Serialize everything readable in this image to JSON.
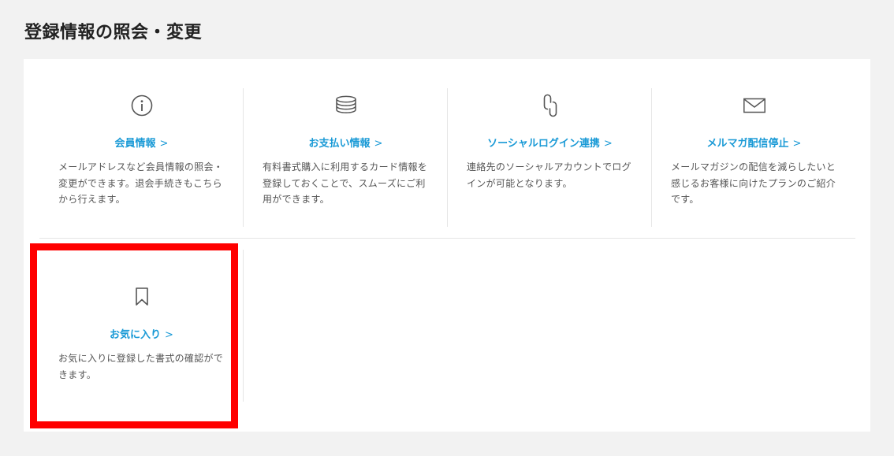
{
  "page": {
    "title": "登録情報の照会・変更"
  },
  "cards": [
    {
      "icon": "info-icon",
      "title": "会員情報",
      "chevron": ">",
      "description": "メールアドレスなど会員情報の照会・変更ができます。退会手続きもこちらから行えます。"
    },
    {
      "icon": "coins-icon",
      "title": "お支払い情報",
      "chevron": ">",
      "description": "有料書式購入に利用するカード情報を登録しておくことで、スムーズにご利用ができます。"
    },
    {
      "icon": "link-icon",
      "title": "ソーシャルログイン連携",
      "chevron": ">",
      "description": "連絡先のソーシャルアカウントでログインが可能となります。"
    },
    {
      "icon": "mail-icon",
      "title": "メルマガ配信停止",
      "chevron": ">",
      "description": "メールマガジンの配信を減らしたいと感じるお客様に向けたプランのご紹介です。"
    },
    {
      "icon": "bookmark-icon",
      "title": "お気に入り",
      "chevron": ">",
      "description": "お気に入りに登録した書式の確認ができます。"
    }
  ],
  "colors": {
    "background": "#f2f2f2",
    "panel": "#ffffff",
    "link": "#1a9ad6",
    "text": "#555555",
    "highlight": "#ff0000",
    "icon": "#555555"
  }
}
